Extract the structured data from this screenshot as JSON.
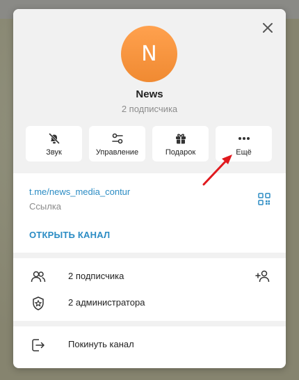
{
  "channel": {
    "avatar_letter": "N",
    "name": "News",
    "subscribers_text": "2 подписчика"
  },
  "actions": [
    {
      "label": "Звук",
      "icon": "bell-off-icon"
    },
    {
      "label": "Управление",
      "icon": "sliders-icon"
    },
    {
      "label": "Подарок",
      "icon": "gift-icon"
    },
    {
      "label": "Ещё",
      "icon": "more-dots-icon"
    }
  ],
  "link": {
    "url": "t.me/news_media_contur",
    "caption": "Ссылка",
    "open_label": "ОТКРЫТЬ КАНАЛ"
  },
  "info": {
    "subscribers": "2 подписчика",
    "admins": "2 администратора"
  },
  "leave": {
    "label": "Покинуть канал"
  },
  "colors": {
    "accent": "#2b8cc4",
    "avatar": "#f7943e",
    "annotation_arrow": "#e0191e"
  }
}
